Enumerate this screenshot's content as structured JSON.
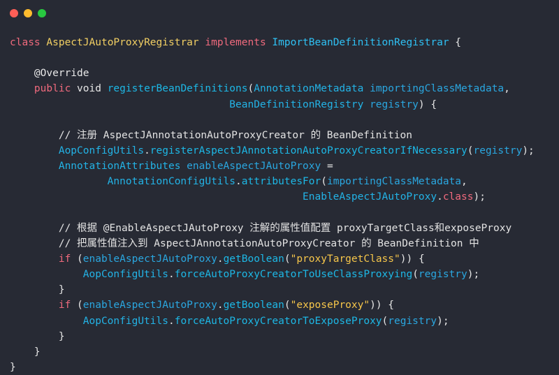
{
  "window": {
    "controls": [
      {
        "name": "close-button",
        "color": "#ff5f57"
      },
      {
        "name": "minimize-button",
        "color": "#febc2e"
      },
      {
        "name": "maximize-button",
        "color": "#28c840"
      }
    ]
  },
  "code": {
    "lines": [
      [
        {
          "t": "class ",
          "c": "kw"
        },
        {
          "t": "AspectJAutoProxyRegistrar ",
          "c": "cls"
        },
        {
          "t": "implements ",
          "c": "kw"
        },
        {
          "t": "ImportBeanDefinitionRegistrar",
          "c": "iface"
        },
        {
          "t": " {",
          "c": "pl"
        }
      ],
      [],
      [
        {
          "t": "    @Override",
          "c": "an"
        }
      ],
      [
        {
          "t": "    public ",
          "c": "kw"
        },
        {
          "t": "void ",
          "c": "pl"
        },
        {
          "t": "registerBeanDefinitions",
          "c": "fn"
        },
        {
          "t": "(",
          "c": "pl"
        },
        {
          "t": "AnnotationMetadata ",
          "c": "ty"
        },
        {
          "t": "importingClassMetadata",
          "c": "prm"
        },
        {
          "t": ",",
          "c": "pl"
        }
      ],
      [
        {
          "t": "                                    BeanDefinitionRegistry ",
          "c": "ty"
        },
        {
          "t": "registry",
          "c": "prm"
        },
        {
          "t": ") {",
          "c": "pl"
        }
      ],
      [],
      [
        {
          "t": "        // 注册 AspectJAnnotationAutoProxyCreator 的 BeanDefinition",
          "c": "cm"
        }
      ],
      [
        {
          "t": "        AopConfigUtils",
          "c": "ty"
        },
        {
          "t": ".",
          "c": "pl"
        },
        {
          "t": "registerAspectJAnnotationAutoProxyCreatorIfNecessary",
          "c": "fn"
        },
        {
          "t": "(",
          "c": "pl"
        },
        {
          "t": "registry",
          "c": "prm"
        },
        {
          "t": ");",
          "c": "pl"
        }
      ],
      [
        {
          "t": "        AnnotationAttributes ",
          "c": "ty"
        },
        {
          "t": "enableAspectJAutoProxy",
          "c": "prm"
        },
        {
          "t": " =",
          "c": "pl"
        }
      ],
      [
        {
          "t": "                AnnotationConfigUtils",
          "c": "ty"
        },
        {
          "t": ".",
          "c": "pl"
        },
        {
          "t": "attributesFor",
          "c": "fn"
        },
        {
          "t": "(",
          "c": "pl"
        },
        {
          "t": "importingClassMetadata",
          "c": "prm"
        },
        {
          "t": ",",
          "c": "pl"
        }
      ],
      [
        {
          "t": "                                                EnableAspectJAutoProxy",
          "c": "ty"
        },
        {
          "t": ".",
          "c": "pl"
        },
        {
          "t": "class",
          "c": "lit"
        },
        {
          "t": ");",
          "c": "pl"
        }
      ],
      [],
      [
        {
          "t": "        // 根据 @EnableAspectJAutoProxy 注解的属性值配置 proxyTargetClass和exposeProxy",
          "c": "cm"
        }
      ],
      [
        {
          "t": "        // 把属性值注入到 AspectJAnnotationAutoProxyCreator 的 BeanDefinition 中",
          "c": "cm"
        }
      ],
      [
        {
          "t": "        if ",
          "c": "kw"
        },
        {
          "t": "(",
          "c": "pl"
        },
        {
          "t": "enableAspectJAutoProxy",
          "c": "prm"
        },
        {
          "t": ".",
          "c": "pl"
        },
        {
          "t": "getBoolean",
          "c": "fn"
        },
        {
          "t": "(",
          "c": "pl"
        },
        {
          "t": "\"proxyTargetClass\"",
          "c": "str"
        },
        {
          "t": ")) {",
          "c": "pl"
        }
      ],
      [
        {
          "t": "            AopConfigUtils",
          "c": "ty"
        },
        {
          "t": ".",
          "c": "pl"
        },
        {
          "t": "forceAutoProxyCreatorToUseClassProxying",
          "c": "fn"
        },
        {
          "t": "(",
          "c": "pl"
        },
        {
          "t": "registry",
          "c": "prm"
        },
        {
          "t": ");",
          "c": "pl"
        }
      ],
      [
        {
          "t": "        }",
          "c": "pl"
        }
      ],
      [
        {
          "t": "        if ",
          "c": "kw"
        },
        {
          "t": "(",
          "c": "pl"
        },
        {
          "t": "enableAspectJAutoProxy",
          "c": "prm"
        },
        {
          "t": ".",
          "c": "pl"
        },
        {
          "t": "getBoolean",
          "c": "fn"
        },
        {
          "t": "(",
          "c": "pl"
        },
        {
          "t": "\"exposeProxy\"",
          "c": "str"
        },
        {
          "t": ")) {",
          "c": "pl"
        }
      ],
      [
        {
          "t": "            AopConfigUtils",
          "c": "ty"
        },
        {
          "t": ".",
          "c": "pl"
        },
        {
          "t": "forceAutoProxyCreatorToExposeProxy",
          "c": "fn"
        },
        {
          "t": "(",
          "c": "pl"
        },
        {
          "t": "registry",
          "c": "prm"
        },
        {
          "t": ");",
          "c": "pl"
        }
      ],
      [
        {
          "t": "        }",
          "c": "pl"
        }
      ],
      [
        {
          "t": "    }",
          "c": "pl"
        }
      ],
      [
        {
          "t": "}",
          "c": "pl"
        }
      ]
    ]
  }
}
